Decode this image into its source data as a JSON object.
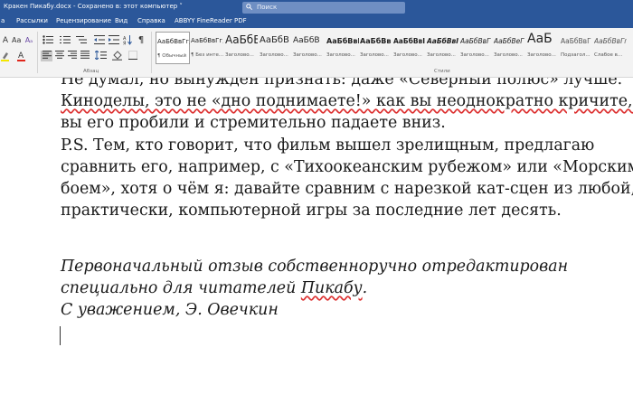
{
  "window": {
    "title": "Кракен Пикабу.docx  -  Сохранено в: этот компьютер  ˅",
    "search_placeholder": "Поиск"
  },
  "menu": {
    "tabs": [
      "а",
      "Рассылки",
      "Рецензирование",
      "Вид",
      "Справка",
      "ABBYY FineReader PDF"
    ]
  },
  "ribbon": {
    "styles": [
      {
        "preview": "АаБбВвГг,",
        "label": "¶ Обычный"
      },
      {
        "preview": "АаБбВвГг,",
        "label": "¶ Без инте..."
      },
      {
        "preview": "АаБбВ",
        "label": "Заголово..."
      },
      {
        "preview": "АаБбВ",
        "label": "Заголово..."
      },
      {
        "preview": "АаБбВ",
        "label": "Заголово..."
      },
      {
        "preview": "АаБбВвI",
        "label": "Заголово..."
      },
      {
        "preview": "АаБбВв",
        "label": "Заголово..."
      },
      {
        "preview": "АаБбВвI",
        "label": "Заголово..."
      },
      {
        "preview": "АаБбВвI",
        "label": "Заголово..."
      },
      {
        "preview": "АаБбВвГ",
        "label": "Заголово..."
      },
      {
        "preview": "АаБбВеГ",
        "label": "Заголово..."
      },
      {
        "preview": "АаБ",
        "label": "Заголово..."
      },
      {
        "preview": "АаБбВвГ",
        "label": "Подзагол..."
      },
      {
        "preview": "АаБбВвГг",
        "label": "Слабое в..."
      }
    ],
    "group_paragraph": "Абзац",
    "group_styles": "Стили"
  },
  "document": {
    "p1": [
      "Не думал, но вынужден признать: даже «Северный полюс» лучше.",
      "Киноделы, это не «дно поднимаете!» как вы неоднократно кричите, а",
      "вы его пробили и стремительно падаете вниз."
    ],
    "p2": [
      "P.S. Тем, кто говорит, что фильм вышел зрелищным, предлагаю",
      "сравнить его, например, с «Тихоокеанским рубежом» или «Морским",
      "боем», хотя о чём я: давайте сравним с нарезкой кат-сцен из любой,",
      "практически, компьютерной игры за последние лет десять."
    ],
    "p3_line1": "Первоначальный отзыв собственноручно отредактирован",
    "p3_line2_a": "специально для читателей ",
    "p3_line2_b": "Пикабу",
    "p3_line2_c": ".",
    "p3_line3": "С уважением, Э. Овечкин"
  }
}
